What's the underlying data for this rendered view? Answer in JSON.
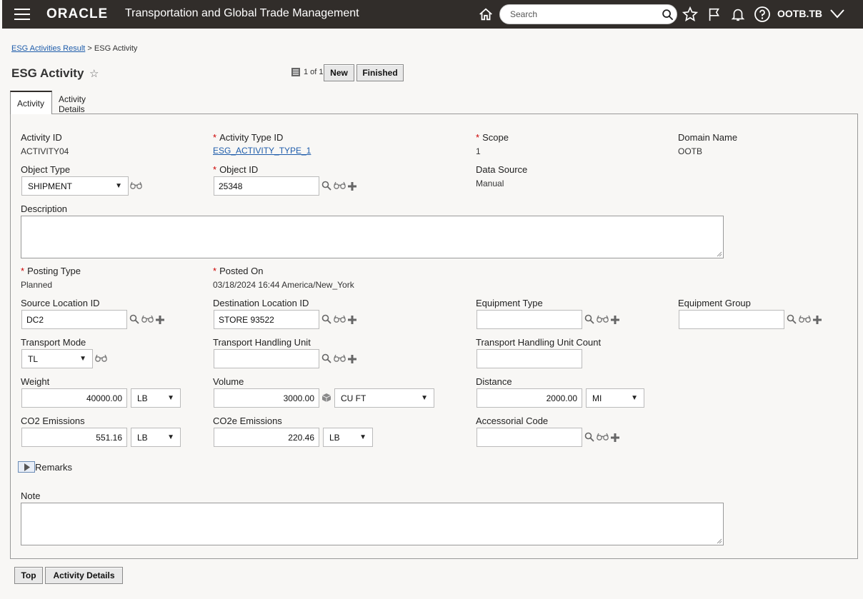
{
  "header": {
    "brand": "ORACLE",
    "app_title": "Transportation and Global Trade Management",
    "search_placeholder": "Search",
    "username": "OOTB.TB"
  },
  "breadcrumb": {
    "parent": "ESG Activities Result",
    "separator": ">",
    "current": "ESG Activity"
  },
  "page": {
    "title": "ESG Activity",
    "pager": "1 of 1",
    "new_label": "New",
    "finished_label": "Finished"
  },
  "tabs": [
    {
      "label": "Activity"
    },
    {
      "label": "Activity Details"
    }
  ],
  "form": {
    "activity_id": {
      "label": "Activity ID",
      "value": "ACTIVITY04"
    },
    "activity_type_id": {
      "label": "Activity Type ID",
      "value": "ESG_ACTIVITY_TYPE_1"
    },
    "scope": {
      "label": "Scope",
      "value": "1"
    },
    "domain_name": {
      "label": "Domain Name",
      "value": "OOTB"
    },
    "object_type": {
      "label": "Object Type",
      "value": "SHIPMENT"
    },
    "object_id": {
      "label": "Object ID",
      "value": "25348"
    },
    "data_source": {
      "label": "Data Source",
      "value": "Manual"
    },
    "description": {
      "label": "Description",
      "value": ""
    },
    "posting_type": {
      "label": "Posting Type",
      "value": "Planned"
    },
    "posted_on": {
      "label": "Posted On",
      "value": "03/18/2024 16:44 America/New_York"
    },
    "source_location_id": {
      "label": "Source Location ID",
      "value": "DC2"
    },
    "destination_location_id": {
      "label": "Destination Location ID",
      "value": "STORE 93522"
    },
    "equipment_type": {
      "label": "Equipment Type",
      "value": ""
    },
    "equipment_group": {
      "label": "Equipment Group",
      "value": ""
    },
    "transport_mode": {
      "label": "Transport Mode",
      "value": "TL"
    },
    "transport_handling_unit": {
      "label": "Transport Handling Unit",
      "value": ""
    },
    "transport_handling_unit_count": {
      "label": "Transport Handling Unit Count",
      "value": ""
    },
    "weight": {
      "label": "Weight",
      "value": "40000.00",
      "uom": "LB"
    },
    "volume": {
      "label": "Volume",
      "value": "3000.00",
      "uom": "CU FT"
    },
    "distance": {
      "label": "Distance",
      "value": "2000.00",
      "uom": "MI"
    },
    "co2_emissions": {
      "label": "CO2 Emissions",
      "value": "551.16",
      "uom": "LB"
    },
    "co2e_emissions": {
      "label": "CO2e Emissions",
      "value": "220.46",
      "uom": "LB"
    },
    "accessorial_code": {
      "label": "Accessorial Code",
      "value": ""
    },
    "remarks_label": "Remarks",
    "note": {
      "label": "Note",
      "value": ""
    }
  },
  "footer": {
    "top_label": "Top",
    "details_label": "Activity Details"
  },
  "colors": {
    "header_bg": "#312d2a",
    "link": "#1f5dab",
    "required": "#cc0000"
  }
}
